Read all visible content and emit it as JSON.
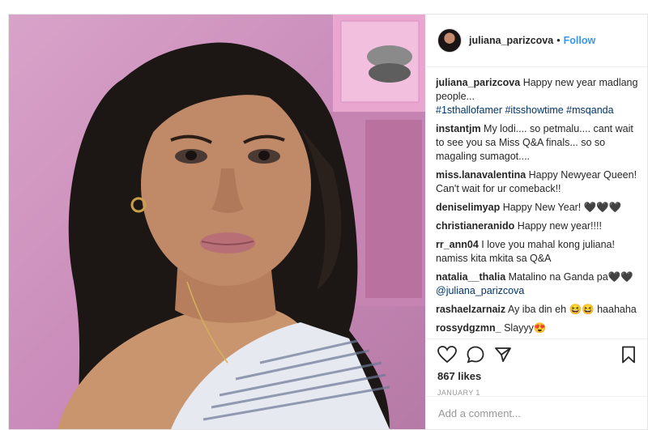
{
  "post": {
    "username": "juliana_parizcova",
    "follow_label": "Follow",
    "separator": "•",
    "caption": {
      "user": "juliana_parizcova",
      "text": "Happy new year madlang people...",
      "tags": "#1sthallofamer #itsshowtime #msqanda"
    },
    "comments": [
      {
        "user": "instantjm",
        "text": "My lodi.... so petmalu.... cant wait to see you sa Miss Q&A finals... so so magaling sumagot...."
      },
      {
        "user": "miss.lanavalentina",
        "text": "Happy Newyear Queen! Can't wait for ur comeback!!"
      },
      {
        "user": "deniselimyap",
        "text": "Happy New Year! 🖤🖤🖤"
      },
      {
        "user": "christianeranido",
        "text": "Happy new year!!!!"
      },
      {
        "user": "rr_ann04",
        "text": "I love you mahal kong juliana! namiss kita mkita sa Q&A"
      },
      {
        "user": "natalia__thalia",
        "text": "Matalino na Ganda pa🖤🖤",
        "mention": "@juliana_parizcova"
      },
      {
        "user": "rashaelzarnaiz",
        "text": "Ay iba din eh 😆😆 haahaha"
      },
      {
        "user": "rossydgzmn_",
        "text": "Slayyy😍"
      }
    ],
    "likes": "867 likes",
    "date": "JANUARY 1",
    "add_comment_placeholder": "Add a comment..."
  },
  "icons": {
    "like": "heart-icon",
    "comment": "comment-icon",
    "share": "share-icon",
    "save": "bookmark-icon",
    "photo": "post-photo"
  },
  "colors": {
    "link": "#3897f0",
    "hashtag": "#003569",
    "muted": "#999999",
    "text": "#262626"
  }
}
